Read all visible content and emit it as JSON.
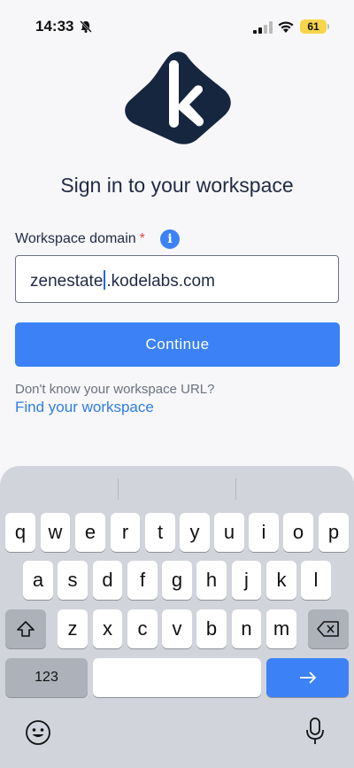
{
  "status_bar": {
    "time": "14:33",
    "battery": "61"
  },
  "page": {
    "title": "Sign in to your workspace",
    "domain_label": "Workspace domain",
    "required_mark": "*",
    "info_icon": "i",
    "domain_value_before_caret": "zenestate",
    "domain_value_after_caret": ".kodelabs.com",
    "continue_label": "Continue",
    "help_text": "Don't know your workspace URL?",
    "find_link": "Find your workspace"
  },
  "keyboard": {
    "row1": [
      "q",
      "w",
      "e",
      "r",
      "t",
      "y",
      "u",
      "i",
      "o",
      "p"
    ],
    "row2": [
      "a",
      "s",
      "d",
      "f",
      "g",
      "h",
      "j",
      "k",
      "l"
    ],
    "row3": [
      "z",
      "x",
      "c",
      "v",
      "b",
      "n",
      "m"
    ],
    "numbers_key": "123"
  },
  "colors": {
    "accent": "#3c82f6",
    "link": "#2f7de1",
    "logo": "#16263f"
  }
}
